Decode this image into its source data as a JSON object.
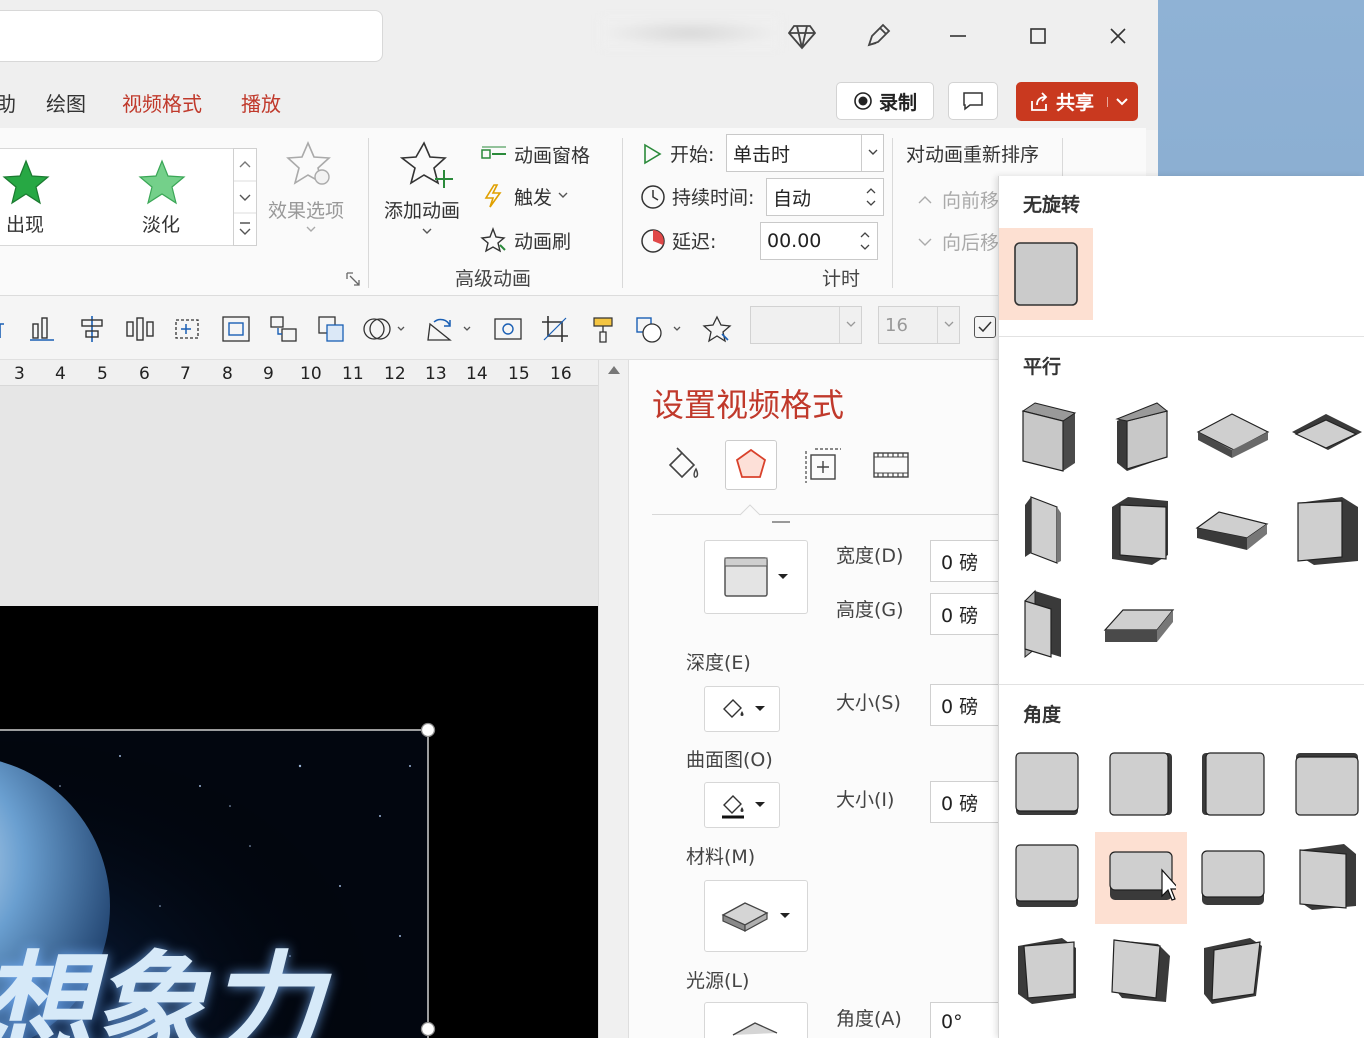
{
  "titlebar": {
    "icons": [
      "diamond-icon",
      "pen-icon",
      "minimize-icon",
      "maximize-icon",
      "close-icon"
    ]
  },
  "tabs": {
    "partial_first": "助",
    "items": [
      {
        "label": "绘图",
        "active": false
      },
      {
        "label": "视频格式",
        "active": true
      },
      {
        "label": "播放",
        "active": true
      }
    ],
    "record_label": "录制",
    "share_label": "共享"
  },
  "ribbon": {
    "gallery": [
      {
        "label": "出现",
        "icon": "green-star-icon"
      },
      {
        "label": "淡化",
        "icon": "green-star-fade-icon"
      }
    ],
    "effect_options": "效果选项",
    "add_animation": "添加动画",
    "advanced_items": [
      "动画窗格",
      "触发",
      "动画刷"
    ],
    "advanced_group": "高级动画",
    "timing": {
      "start_label": "开始:",
      "start_value": "单击时",
      "duration_label": "持续时间:",
      "duration_value": "自动",
      "delay_label": "延迟:",
      "delay_value": "00.00",
      "group": "计时"
    },
    "reorder": {
      "title": "对动画重新排序",
      "forward": "向前移",
      "backward": "向后移"
    }
  },
  "toolbar2": {
    "font_size": "16"
  },
  "ruler": {
    "ticks": [
      "3",
      "4",
      "5",
      "6",
      "7",
      "8",
      "9",
      "10",
      "11",
      "12",
      "13",
      "14",
      "15",
      "16"
    ]
  },
  "slide": {
    "text": "想象力"
  },
  "format_pane": {
    "title": "设置视频格式",
    "tabs": [
      "fill-icon",
      "effects-icon",
      "size-icon",
      "video-icon"
    ],
    "width_label": "宽度(D)",
    "width_value": "0 磅",
    "height_label": "高度(G)",
    "height_value": "0 磅",
    "depth_label": "深度(E)",
    "depth_size_label": "大小(S)",
    "depth_size_value": "0 磅",
    "contour_label": "曲面图(O)",
    "contour_size_label": "大小(I)",
    "contour_size_value": "0 磅",
    "material_label": "材料(M)",
    "lighting_label": "光源(L)",
    "angle_label": "角度(A)",
    "angle_value": "0°"
  },
  "rotation_menu": {
    "sections": [
      {
        "title": "无旋转"
      },
      {
        "title": "平行"
      },
      {
        "title": "角度"
      }
    ]
  }
}
